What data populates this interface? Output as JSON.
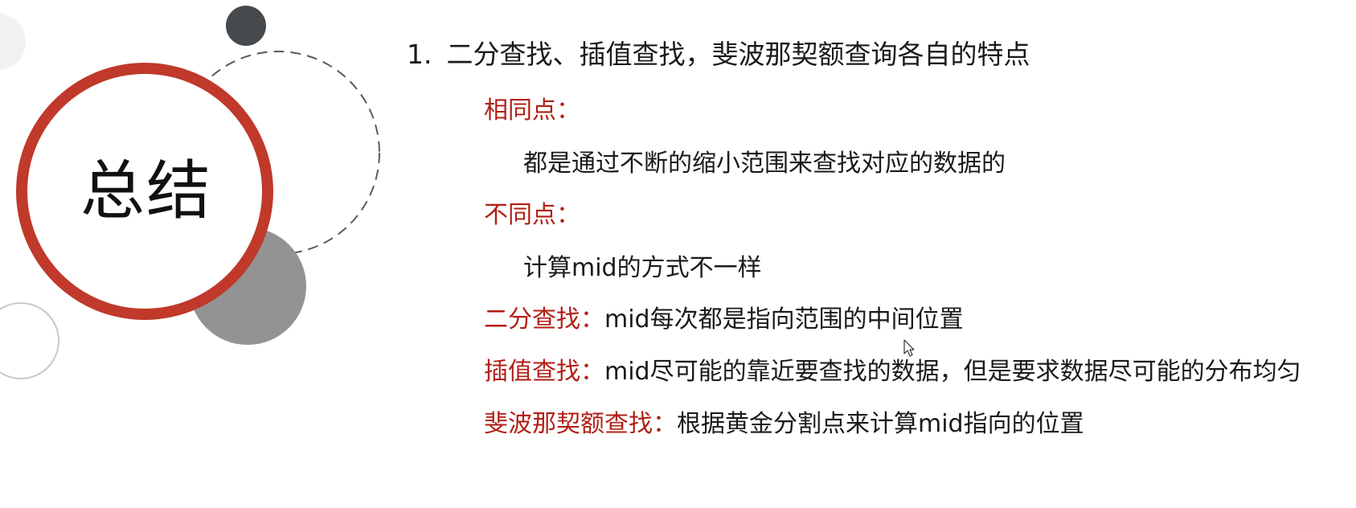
{
  "colors": {
    "accent_red": "#b11f16",
    "ring_red": "#c0392b",
    "dark_gray": "#474a4d",
    "mid_gray": "#939393",
    "light_gray": "#f2f2f2"
  },
  "badge": {
    "title": "总结"
  },
  "summary": {
    "heading_number": "1.",
    "heading_text": "二分查找、插值查找，斐波那契额查询各自的特点",
    "items": [
      {
        "label": "相同点：",
        "text": ""
      },
      {
        "label": "",
        "text": "都是通过不断的缩小范围来查找对应的数据的"
      },
      {
        "label": "不同点：",
        "text": ""
      },
      {
        "label": "",
        "text": "计算mid的方式不一样"
      },
      {
        "label": "二分查找：",
        "text": "mid每次都是指向范围的中间位置"
      },
      {
        "label": "插值查找：",
        "text": "mid尽可能的靠近要查找的数据，但是要求数据尽可能的分布均匀"
      },
      {
        "label": "斐波那契额查找：",
        "text": "根据黄金分割点来计算mid指向的位置"
      }
    ]
  },
  "icons": {
    "cursor": "mouse-pointer-icon"
  }
}
